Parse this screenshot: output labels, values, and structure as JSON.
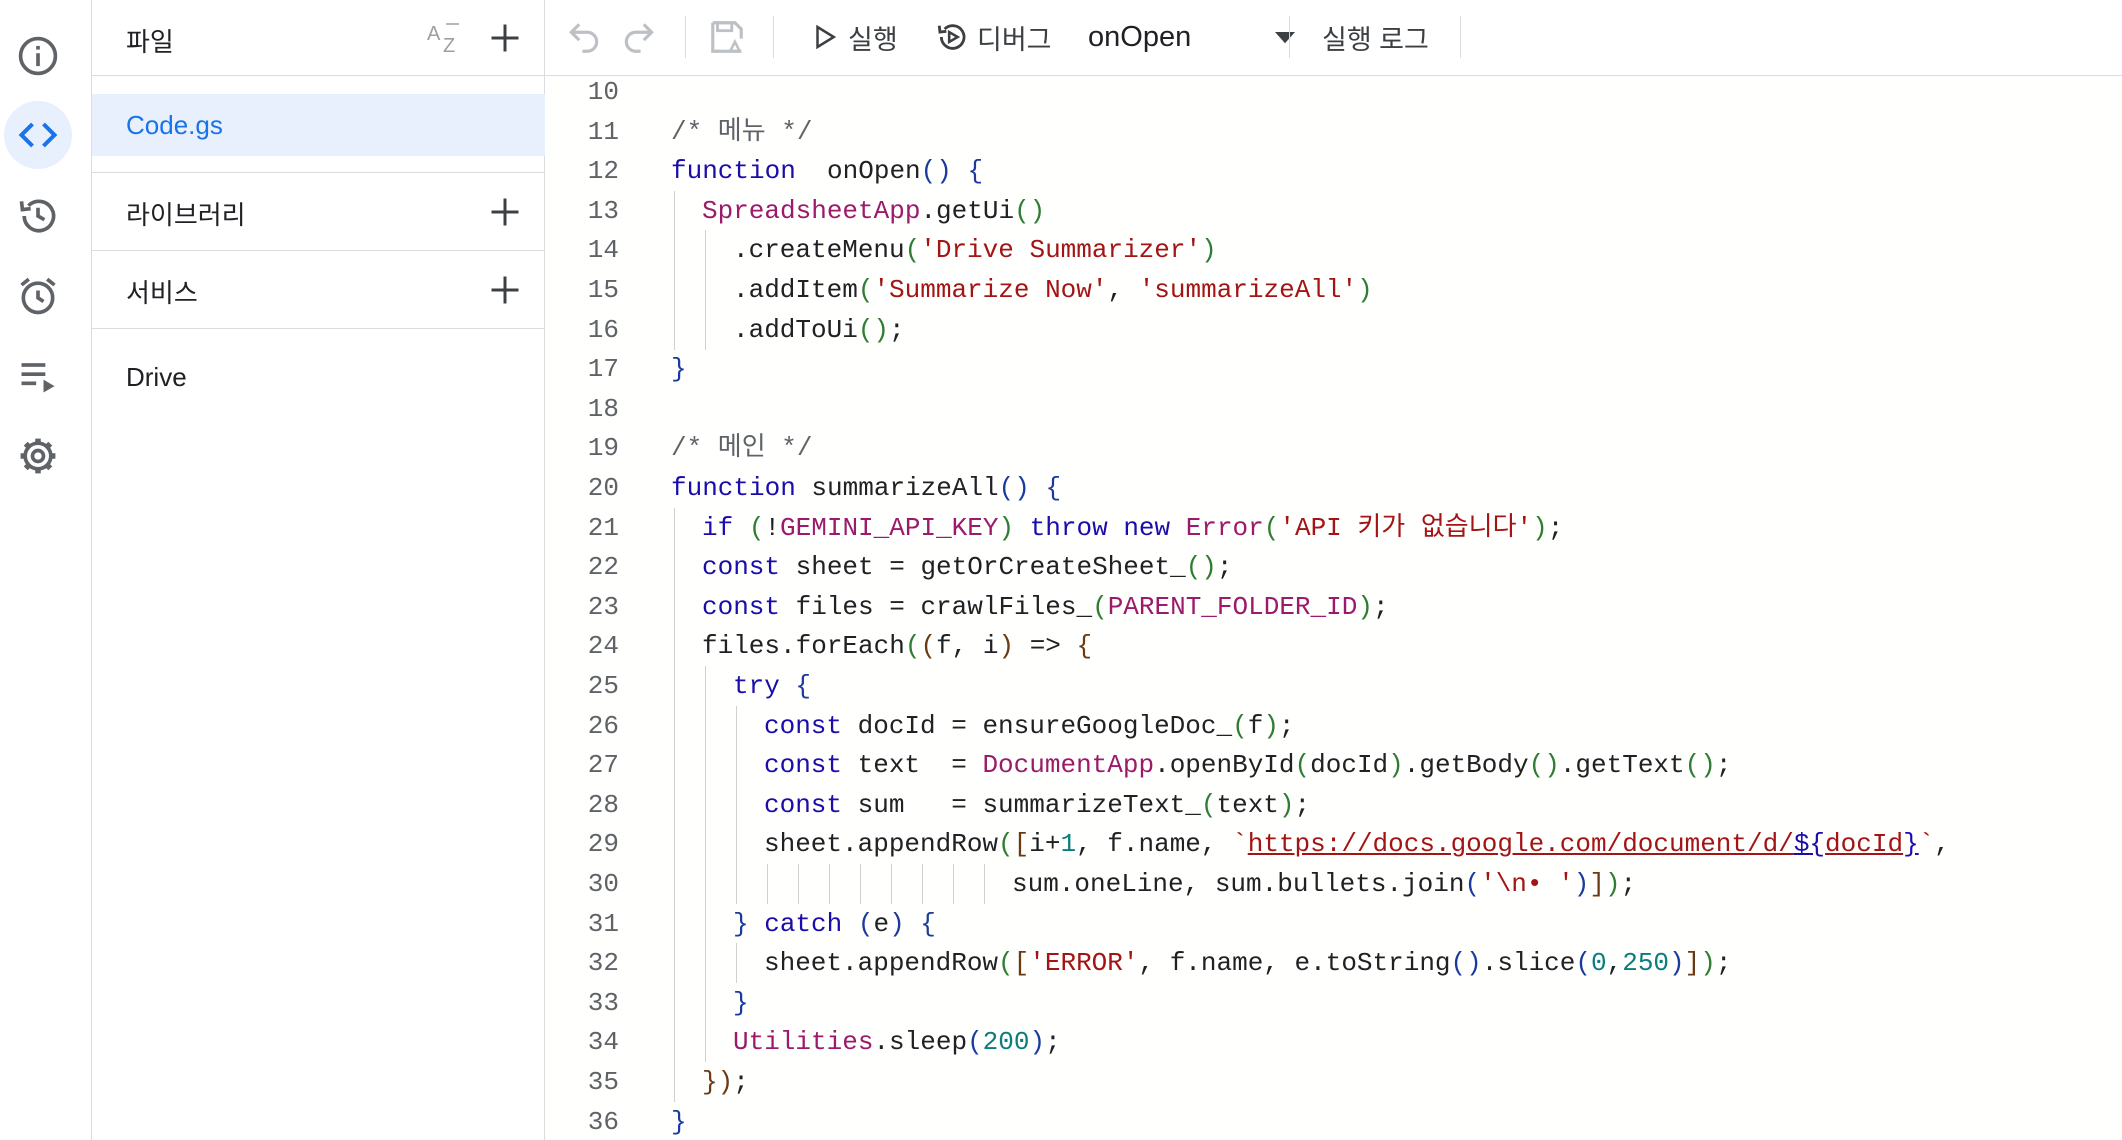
{
  "colors": {
    "accent": "#1a73e8",
    "selected_bg": "#e8f0fe",
    "border": "#dadce0"
  },
  "rail": [
    {
      "name": "overview",
      "icon": "info-icon"
    },
    {
      "name": "editor",
      "icon": "code-brackets-icon",
      "active": true
    },
    {
      "name": "history",
      "icon": "history-icon"
    },
    {
      "name": "triggers",
      "icon": "alarm-clock-icon"
    },
    {
      "name": "executions",
      "icon": "list-play-icon"
    },
    {
      "name": "settings",
      "icon": "gear-icon"
    }
  ],
  "sidebar": {
    "files_title": "파일",
    "files": [
      "Code.gs"
    ],
    "libraries_title": "라이브러리",
    "services_title": "서비스",
    "services": [
      "Drive"
    ]
  },
  "toolbar": {
    "run_label": "실행",
    "debug_label": "디버그",
    "function_selected": "onOpen",
    "exec_log_label": "실행 로그"
  },
  "code_lines": [
    {
      "n": "10",
      "indent": 0,
      "tokens": []
    },
    {
      "n": "11",
      "indent": 0,
      "tokens": [
        [
          "cm",
          "/* 메뉴 */"
        ]
      ]
    },
    {
      "n": "12",
      "indent": 0,
      "tokens": [
        [
          "kw",
          "function"
        ],
        [
          "",
          "  onOpen"
        ],
        [
          "br1",
          "()"
        ],
        [
          "",
          " "
        ],
        [
          "br1",
          "{"
        ]
      ]
    },
    {
      "n": "13",
      "indent": 1,
      "tokens": [
        [
          "cls",
          "SpreadsheetApp"
        ],
        [
          "",
          ".getUi"
        ],
        [
          "br2",
          "()"
        ]
      ]
    },
    {
      "n": "14",
      "indent": 2,
      "tokens": [
        [
          "",
          ".createMenu"
        ],
        [
          "br2",
          "("
        ],
        [
          "str",
          "'Drive Summarizer'"
        ],
        [
          "br2",
          ")"
        ]
      ]
    },
    {
      "n": "15",
      "indent": 2,
      "tokens": [
        [
          "",
          ".addItem"
        ],
        [
          "br2",
          "("
        ],
        [
          "str",
          "'Summarize Now'"
        ],
        [
          "",
          ", "
        ],
        [
          "str",
          "'summarizeAll'"
        ],
        [
          "br2",
          ")"
        ]
      ]
    },
    {
      "n": "16",
      "indent": 2,
      "tokens": [
        [
          "",
          ".addToUi"
        ],
        [
          "br2",
          "()"
        ],
        [
          "",
          ";"
        ]
      ]
    },
    {
      "n": "17",
      "indent": 0,
      "tokens": [
        [
          "br1",
          "}"
        ]
      ]
    },
    {
      "n": "18",
      "indent": 0,
      "tokens": []
    },
    {
      "n": "19",
      "indent": 0,
      "tokens": [
        [
          "cm",
          "/* 메인 */"
        ]
      ]
    },
    {
      "n": "20",
      "indent": 0,
      "tokens": [
        [
          "kw",
          "function"
        ],
        [
          "",
          " summarizeAll"
        ],
        [
          "br1",
          "()"
        ],
        [
          "",
          " "
        ],
        [
          "br1",
          "{"
        ]
      ]
    },
    {
      "n": "21",
      "indent": 1,
      "tokens": [
        [
          "kw",
          "if"
        ],
        [
          "",
          " "
        ],
        [
          "br2",
          "("
        ],
        [
          "",
          "!"
        ],
        [
          "cst",
          "GEMINI_API_KEY"
        ],
        [
          "br2",
          ")"
        ],
        [
          "",
          " "
        ],
        [
          "kw",
          "throw"
        ],
        [
          "",
          " "
        ],
        [
          "kw",
          "new"
        ],
        [
          "",
          " "
        ],
        [
          "cls",
          "Error"
        ],
        [
          "br2",
          "("
        ],
        [
          "str",
          "'API 키가 없습니다'"
        ],
        [
          "br2",
          ")"
        ],
        [
          "",
          ";"
        ]
      ]
    },
    {
      "n": "22",
      "indent": 1,
      "tokens": [
        [
          "kw",
          "const"
        ],
        [
          "",
          " sheet = getOrCreateSheet_"
        ],
        [
          "br2",
          "()"
        ],
        [
          "",
          ";"
        ]
      ]
    },
    {
      "n": "23",
      "indent": 1,
      "tokens": [
        [
          "kw",
          "const"
        ],
        [
          "",
          " files = crawlFiles_"
        ],
        [
          "br2",
          "("
        ],
        [
          "cst",
          "PARENT_FOLDER_ID"
        ],
        [
          "br2",
          ")"
        ],
        [
          "",
          ";"
        ]
      ]
    },
    {
      "n": "24",
      "indent": 1,
      "tokens": [
        [
          "",
          "files.forEach"
        ],
        [
          "br2",
          "("
        ],
        [
          "br3",
          "("
        ],
        [
          "",
          "f, i"
        ],
        [
          "br3",
          ")"
        ],
        [
          "",
          " => "
        ],
        [
          "br3",
          "{"
        ]
      ]
    },
    {
      "n": "25",
      "indent": 2,
      "tokens": [
        [
          "kw",
          "try"
        ],
        [
          "",
          " "
        ],
        [
          "br1",
          "{"
        ]
      ]
    },
    {
      "n": "26",
      "indent": 3,
      "tokens": [
        [
          "kw",
          "const"
        ],
        [
          "",
          " docId = ensureGoogleDoc_"
        ],
        [
          "br2",
          "("
        ],
        [
          "",
          "f"
        ],
        [
          "br2",
          ")"
        ],
        [
          "",
          ";"
        ]
      ]
    },
    {
      "n": "27",
      "indent": 3,
      "tokens": [
        [
          "kw",
          "const"
        ],
        [
          "",
          " text  = "
        ],
        [
          "cls",
          "DocumentApp"
        ],
        [
          "",
          ".openById"
        ],
        [
          "br2",
          "("
        ],
        [
          "",
          "docId"
        ],
        [
          "br2",
          ")"
        ],
        [
          "",
          ".getBody"
        ],
        [
          "br2",
          "()"
        ],
        [
          "",
          ".getText"
        ],
        [
          "br2",
          "()"
        ],
        [
          "",
          ";"
        ]
      ]
    },
    {
      "n": "28",
      "indent": 3,
      "tokens": [
        [
          "kw",
          "const"
        ],
        [
          "",
          " sum   = summarizeText_"
        ],
        [
          "br2",
          "("
        ],
        [
          "",
          "text"
        ],
        [
          "br2",
          ")"
        ],
        [
          "",
          ";"
        ]
      ]
    },
    {
      "n": "29",
      "indent": 3,
      "tokens": [
        [
          "",
          "sheet.appendRow"
        ],
        [
          "br2",
          "("
        ],
        [
          "br3",
          "["
        ],
        [
          "",
          "i+"
        ],
        [
          "num",
          "1"
        ],
        [
          "",
          ", f.name, "
        ],
        [
          "str",
          "`"
        ],
        [
          "url",
          "https://docs.google.com/document/d/"
        ],
        [
          "ph",
          "${"
        ],
        [
          "url",
          "docId"
        ],
        [
          "ph",
          "}"
        ],
        [
          "str",
          "`"
        ],
        [
          "",
          ","
        ]
      ]
    },
    {
      "n": "30",
      "indent": 11,
      "tokens": [
        [
          "",
          "sum.oneLine, sum.bullets.join"
        ],
        [
          "br1",
          "("
        ],
        [
          "str",
          "'\\n• '"
        ],
        [
          "br1",
          ")"
        ],
        [
          "br3",
          "]"
        ],
        [
          "br2",
          ")"
        ],
        [
          "",
          ";"
        ]
      ]
    },
    {
      "n": "31",
      "indent": 2,
      "tokens": [
        [
          "br1",
          "}"
        ],
        [
          "",
          " "
        ],
        [
          "kw",
          "catch"
        ],
        [
          "",
          " "
        ],
        [
          "br1",
          "("
        ],
        [
          "",
          "e"
        ],
        [
          "br1",
          ")"
        ],
        [
          "",
          " "
        ],
        [
          "br1",
          "{"
        ]
      ]
    },
    {
      "n": "32",
      "indent": 3,
      "tokens": [
        [
          "",
          "sheet.appendRow"
        ],
        [
          "br2",
          "("
        ],
        [
          "br3",
          "["
        ],
        [
          "str",
          "'ERROR'"
        ],
        [
          "",
          ", f.name, e.toString"
        ],
        [
          "br1",
          "()"
        ],
        [
          "",
          ".slice"
        ],
        [
          "br1",
          "("
        ],
        [
          "num",
          "0"
        ],
        [
          "",
          ","
        ],
        [
          "num",
          "250"
        ],
        [
          "br1",
          ")"
        ],
        [
          "br3",
          "]"
        ],
        [
          "br2",
          ")"
        ],
        [
          "",
          ";"
        ]
      ]
    },
    {
      "n": "33",
      "indent": 2,
      "tokens": [
        [
          "br1",
          "}"
        ]
      ]
    },
    {
      "n": "34",
      "indent": 2,
      "tokens": [
        [
          "cls",
          "Utilities"
        ],
        [
          "",
          ".sleep"
        ],
        [
          "br1",
          "("
        ],
        [
          "num",
          "200"
        ],
        [
          "br1",
          ")"
        ],
        [
          "",
          ";"
        ]
      ]
    },
    {
      "n": "35",
      "indent": 1,
      "tokens": [
        [
          "br3",
          "})"
        ],
        [
          "",
          ";"
        ]
      ]
    },
    {
      "n": "36",
      "indent": 0,
      "tokens": [
        [
          "br1",
          "}"
        ]
      ]
    }
  ]
}
